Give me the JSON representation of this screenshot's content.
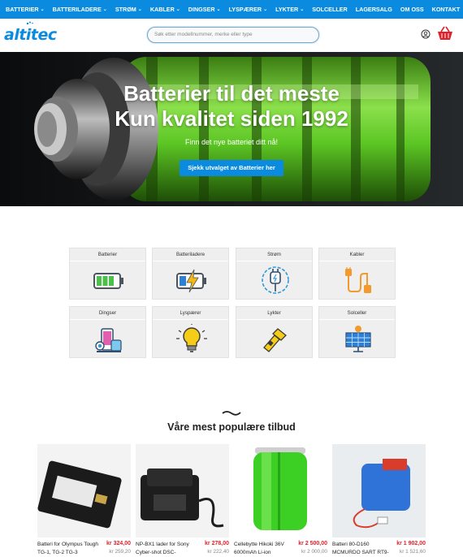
{
  "nav": {
    "items": [
      {
        "label": "BATTERIER",
        "dropdown": true
      },
      {
        "label": "BATTERILADERE",
        "dropdown": true
      },
      {
        "label": "STRØM",
        "dropdown": true
      },
      {
        "label": "KABLER",
        "dropdown": true
      },
      {
        "label": "DINGSER",
        "dropdown": true
      },
      {
        "label": "LYSPÆRER",
        "dropdown": true
      },
      {
        "label": "LYKTER",
        "dropdown": true
      },
      {
        "label": "SOLCELLER",
        "dropdown": false
      },
      {
        "label": "LAGERSALG",
        "dropdown": false
      },
      {
        "label": "OM OSS",
        "dropdown": false
      },
      {
        "label": "KONTAKT",
        "dropdown": false
      }
    ],
    "bg_color": "#0a8be0"
  },
  "header": {
    "logo": "altitec",
    "search_placeholder": "Søk etter modellnummer, merke eller type",
    "icons": [
      "account-icon",
      "basket-icon"
    ]
  },
  "hero": {
    "title_line1": "Batterier til det meste",
    "title_line2": "Kun kvalitet siden 1992",
    "subtitle": "Finn det nye batteriet ditt nå!",
    "cta": "Sjekk utvalget av Batterier her"
  },
  "categories": [
    {
      "label": "Batterier",
      "icon": "battery-icon"
    },
    {
      "label": "Batteriladere",
      "icon": "charging-battery-icon"
    },
    {
      "label": "Strøm",
      "icon": "power-plug-icon"
    },
    {
      "label": "Kabler",
      "icon": "cable-icon"
    },
    {
      "label": "Dingser",
      "icon": "gadgets-icon"
    },
    {
      "label": "Lyspærer",
      "icon": "light-bulb-icon"
    },
    {
      "label": "Lykter",
      "icon": "flashlight-icon"
    },
    {
      "label": "Solceller",
      "icon": "solar-panel-icon"
    }
  ],
  "offers": {
    "heading": "Våre mest populære tilbud",
    "products": [
      {
        "name": "Batteri for Olympus Tough TG-1, TG-2 TG-3",
        "price": "kr 324,00",
        "old_price": "kr 259,20"
      },
      {
        "name": "NP-BX1 lader for Sony Cyber-shot DSC-",
        "price": "kr 278,00",
        "old_price": "kr 222,40"
      },
      {
        "name": "Cellebytte Hikoki 36V 6000mAh Li-ion",
        "price": "kr 2 500,00",
        "old_price": "kr 2 000,00"
      },
      {
        "name": "Batteri 80-D160 MCMURDO SART RT9-",
        "price": "kr 1 902,00",
        "old_price": "kr 1 521,60"
      }
    ]
  },
  "colors": {
    "accent": "#0a8be0",
    "price": "#e2202a"
  }
}
